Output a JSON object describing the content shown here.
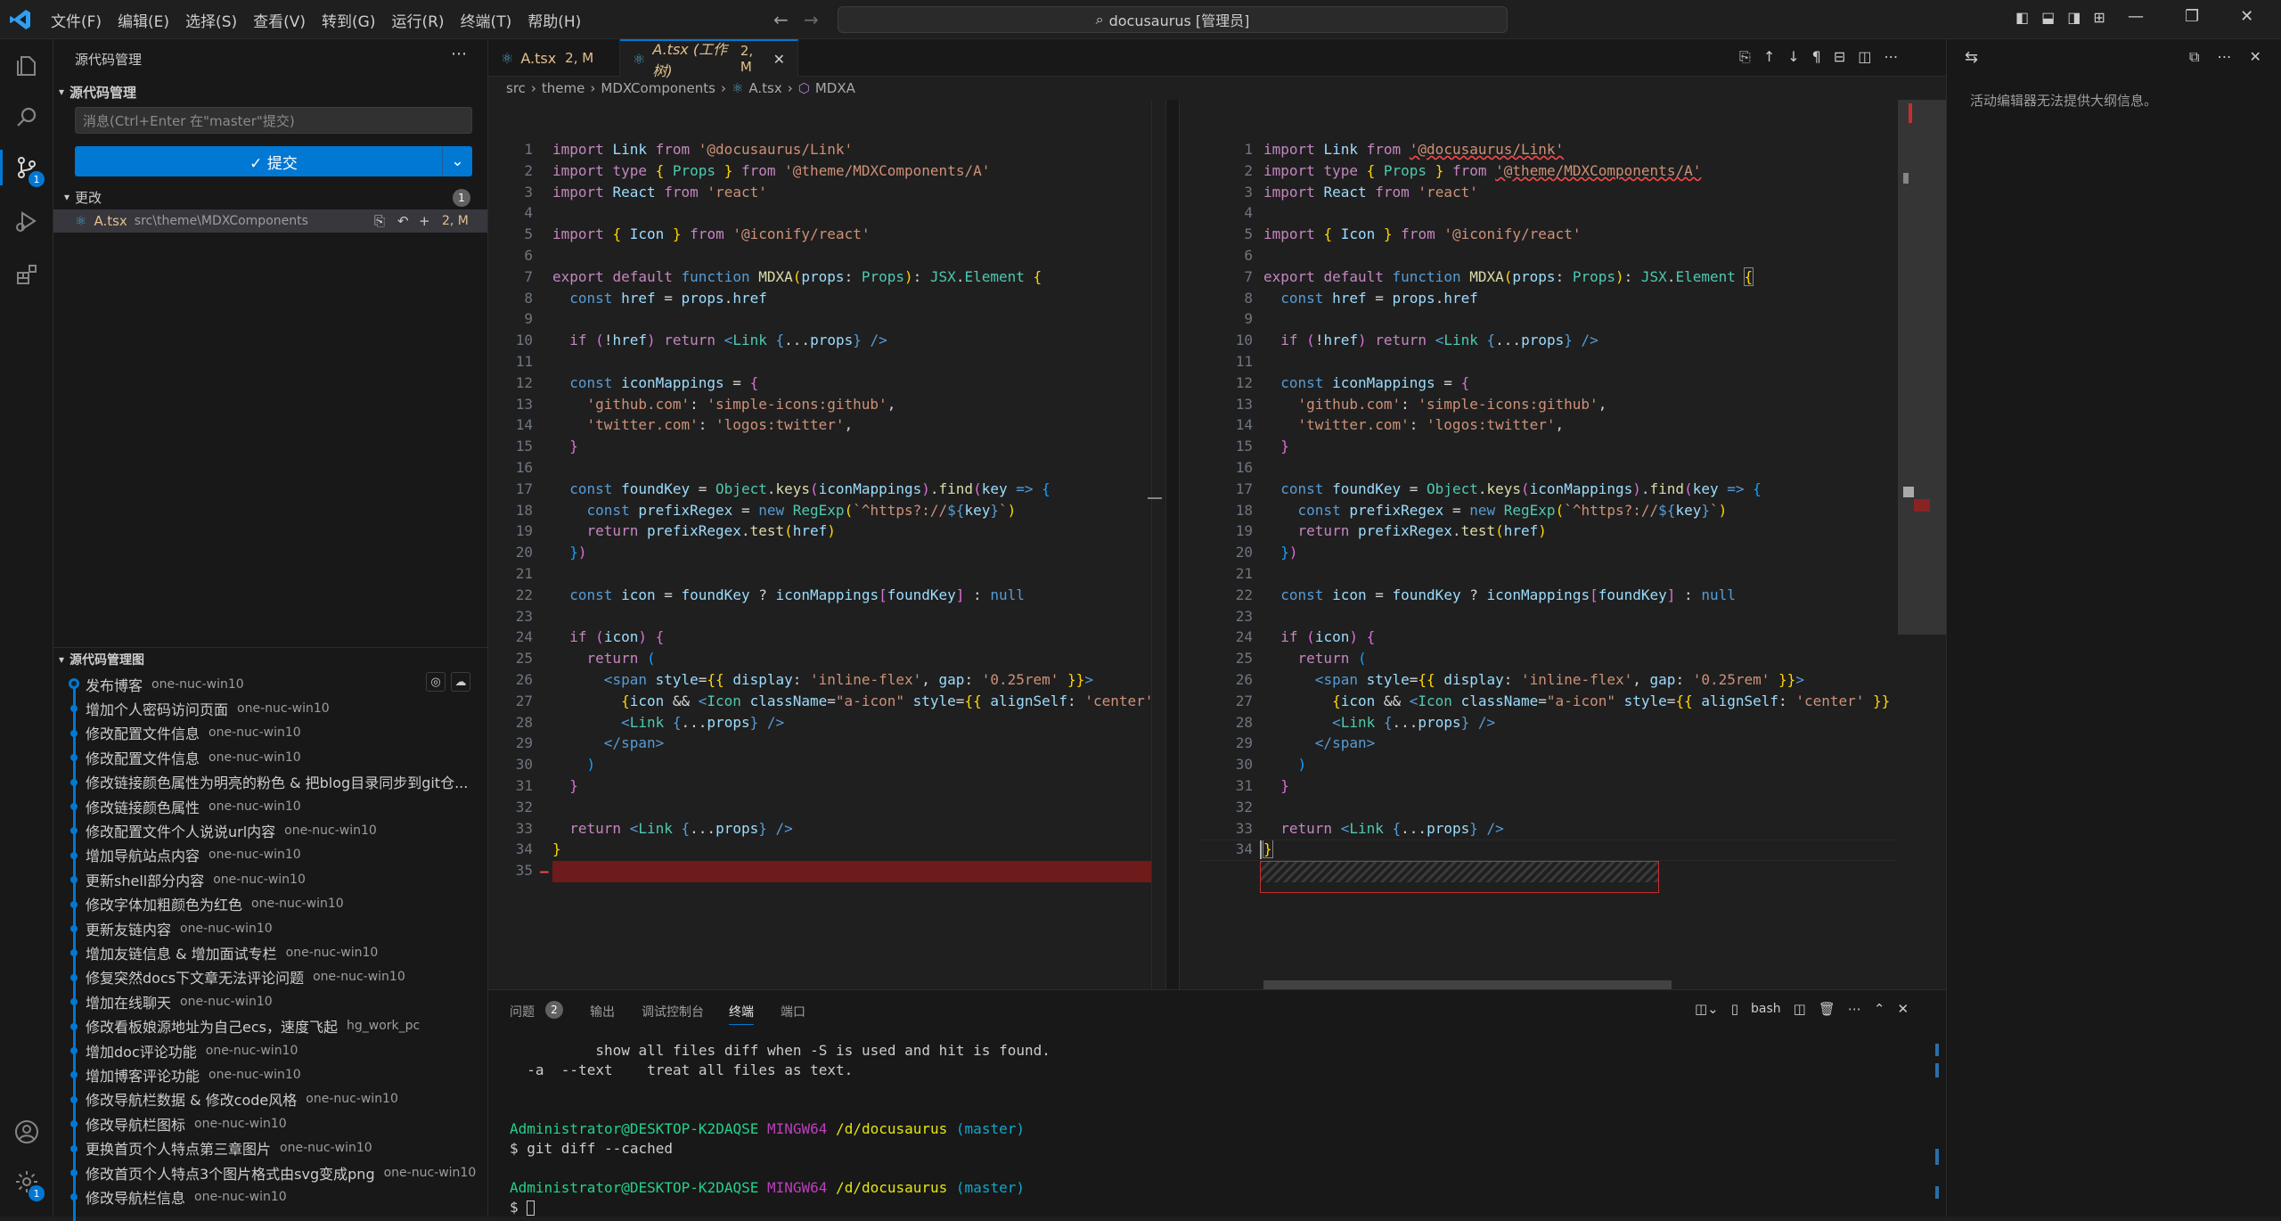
{
  "menu": [
    "文件(F)",
    "编辑(E)",
    "选择(S)",
    "查看(V)",
    "转到(G)",
    "运行(R)",
    "终端(T)",
    "帮助(H)"
  ],
  "command_center": "docusaurus [管理员]",
  "activity": {
    "scm_badge": "1",
    "settings_badge": "1"
  },
  "sidebar": {
    "title": "源代码管理",
    "section_title": "源代码管理",
    "commit_placeholder": "消息(Ctrl+Enter 在\"master\"提交)",
    "commit_label": "✓ 提交",
    "changes_label": "更改",
    "changes_count": "1",
    "changed_file": {
      "name": "A.tsx",
      "path": "src\\theme\\MDXComponents",
      "status": "2, M"
    },
    "graph_title": "源代码管理图",
    "graph": [
      {
        "msg": "发布博客",
        "author": "one-nuc-win10"
      },
      {
        "msg": "增加个人密码访问页面",
        "author": "one-nuc-win10"
      },
      {
        "msg": "修改配置文件信息",
        "author": "one-nuc-win10"
      },
      {
        "msg": "修改配置文件信息",
        "author": "one-nuc-win10"
      },
      {
        "msg": "修改链接颜色属性为明亮的粉色 & 把blog目录同步到git仓...",
        "author": ""
      },
      {
        "msg": "修改链接颜色属性",
        "author": "one-nuc-win10"
      },
      {
        "msg": "修改配置文件个人说说url内容",
        "author": "one-nuc-win10"
      },
      {
        "msg": "增加导航站点内容",
        "author": "one-nuc-win10"
      },
      {
        "msg": "更新shell部分内容",
        "author": "one-nuc-win10"
      },
      {
        "msg": "修改字体加粗颜色为红色",
        "author": "one-nuc-win10"
      },
      {
        "msg": "更新友链内容",
        "author": "one-nuc-win10"
      },
      {
        "msg": "增加友链信息 & 增加面试专栏",
        "author": "one-nuc-win10"
      },
      {
        "msg": "修复突然docs下文章无法评论问题",
        "author": "one-nuc-win10"
      },
      {
        "msg": "增加在线聊天",
        "author": "one-nuc-win10"
      },
      {
        "msg": "修改看板娘源地址为自己ecs，速度飞起",
        "author": "hg_work_pc"
      },
      {
        "msg": "增加doc评论功能",
        "author": "one-nuc-win10"
      },
      {
        "msg": "增加博客评论功能",
        "author": "one-nuc-win10"
      },
      {
        "msg": "修改导航栏数据 & 修改code风格",
        "author": "one-nuc-win10"
      },
      {
        "msg": "修改导航栏图标",
        "author": "one-nuc-win10"
      },
      {
        "msg": "更换首页个人特点第三章图片",
        "author": "one-nuc-win10"
      },
      {
        "msg": "修改首页个人特点3个图片格式由svg变成png",
        "author": "one-nuc-win10"
      },
      {
        "msg": "修改导航栏信息",
        "author": "one-nuc-win10"
      }
    ]
  },
  "tabs": [
    {
      "label": "A.tsx",
      "status": "2, M"
    },
    {
      "label": "A.tsx (工作树)",
      "status": "2, M"
    }
  ],
  "breadcrumb": [
    "src",
    "theme",
    "MDXComponents",
    "A.tsx",
    "MDXA"
  ],
  "outline_message": "活动编辑器无法提供大纲信息。",
  "panel": {
    "tabs": [
      "问题",
      "输出",
      "调试控制台",
      "终端",
      "端口"
    ],
    "problems_count": "2",
    "shell": "bash",
    "terminal": [
      "          show all files diff when -S is used and hit is found.",
      "  -a  --text    treat all files as text.",
      "",
      "",
      "Administrator@DESKTOP-K2DAQSE MINGW64 /d/docusaurus (master)",
      "$ git diff --cached",
      "",
      "Administrator@DESKTOP-K2DAQSE MINGW64 /d/docusaurus (master)",
      "$ "
    ]
  },
  "colors": {
    "accent": "#0078d4",
    "deleted": "#6e1b1b",
    "modified": "#e2c08d",
    "error": "#f14c4c"
  }
}
